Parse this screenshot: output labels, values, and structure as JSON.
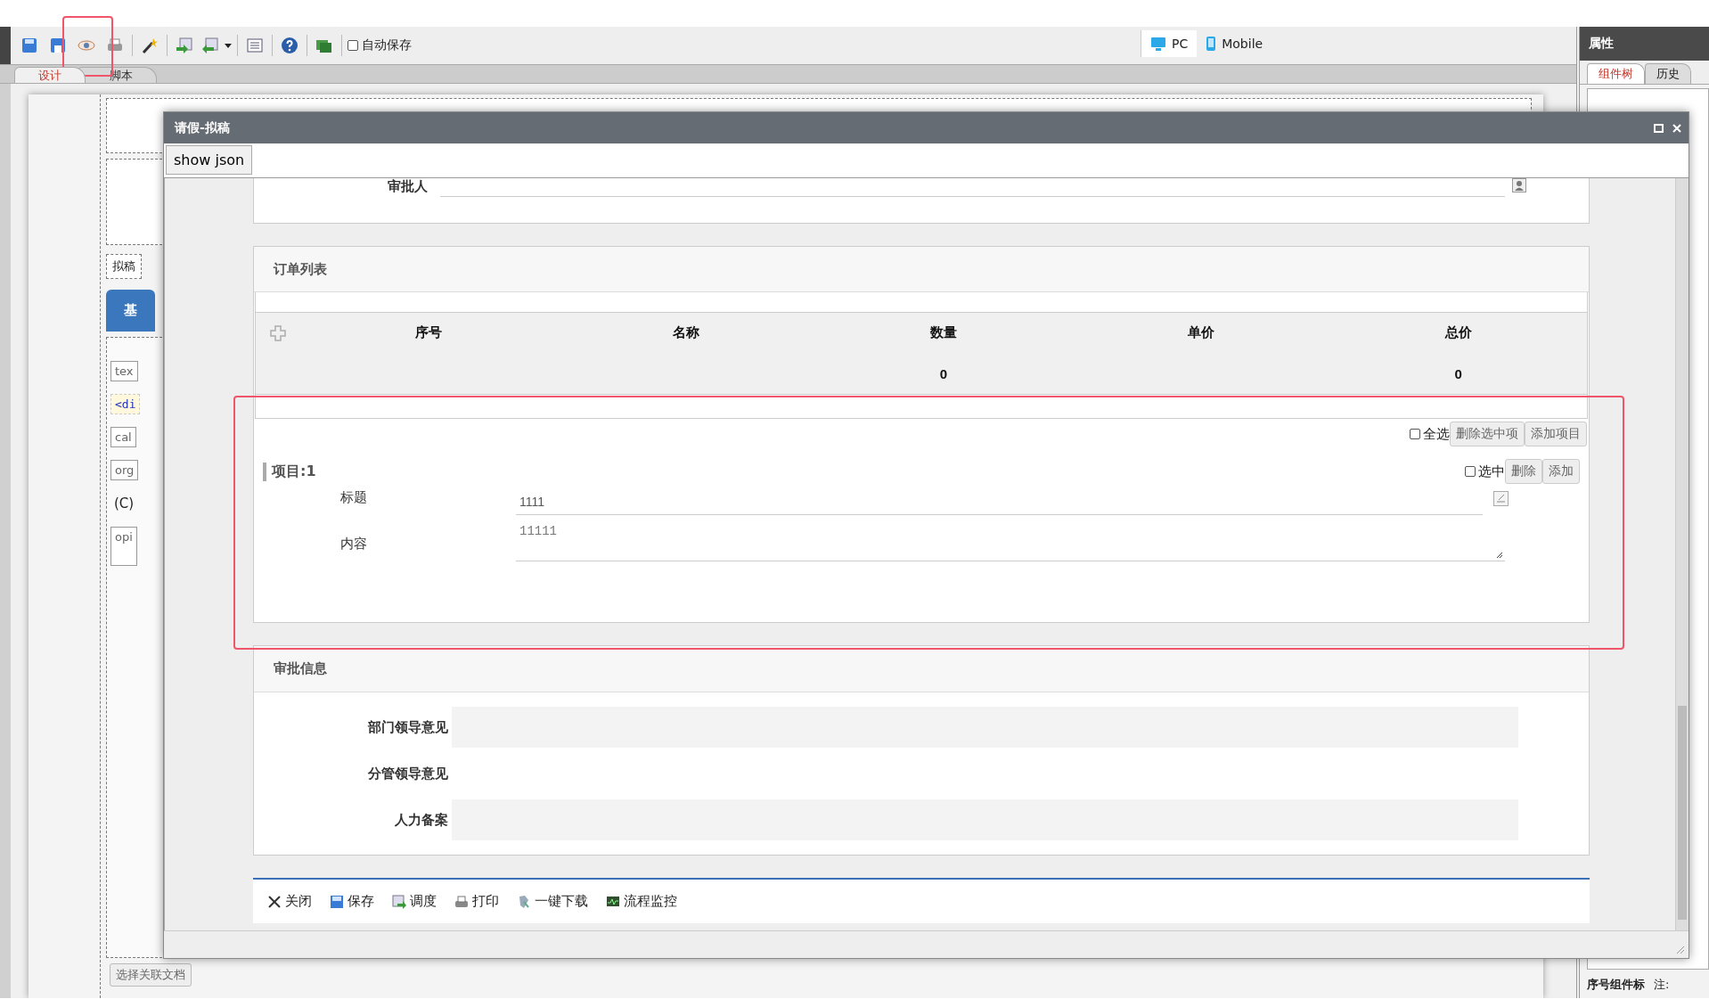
{
  "toolbar": {
    "autosave": {
      "label": "自动保存",
      "checked": false
    },
    "devices": [
      {
        "label": "PC",
        "kind": "pc",
        "selected": true
      },
      {
        "label": "Mobile",
        "kind": "mobile",
        "selected": false
      }
    ]
  },
  "editor_tabs": [
    {
      "label": "设计",
      "selected": true
    },
    {
      "label": "脚本",
      "selected": false
    }
  ],
  "design_canvas": {
    "draft_label": "拟稿",
    "section_tab": "基",
    "field_stubs": [
      {
        "text": "tex",
        "kind": "input"
      },
      {
        "text": "<di",
        "kind": "code"
      },
      {
        "text": "cal",
        "kind": "input"
      },
      {
        "text": "org",
        "kind": "input"
      },
      {
        "text": "(C)",
        "kind": "plain"
      },
      {
        "text": "opi",
        "kind": "textarea"
      }
    ],
    "link_document_button": "选择关联文档"
  },
  "properties_panel": {
    "title": "属性",
    "tabs": [
      {
        "label": "组件树",
        "selected": true
      },
      {
        "label": "历史",
        "selected": false
      }
    ],
    "footer_columns": [
      "序号组件标",
      "注:"
    ]
  },
  "dialog": {
    "title": "请假-拟稿",
    "show_json_button": "show json",
    "approver": {
      "label": "审批人"
    },
    "order_section": {
      "title": "订单列表",
      "columns": [
        {
          "label": "序号"
        },
        {
          "label": "名称"
        },
        {
          "label": "数量",
          "total": "0"
        },
        {
          "label": "单价"
        },
        {
          "label": "总价",
          "total": "0"
        }
      ],
      "select_all": {
        "label": "全选",
        "checked": false
      },
      "delete_selected_button": "删除选中项",
      "add_item_button": "添加项目",
      "items": [
        {
          "heading": "项目:1",
          "select": {
            "label": "选中",
            "checked": false
          },
          "delete_button": "删除",
          "add_button": "添加",
          "fields": [
            {
              "label": "标题",
              "value": "1111",
              "kind": "input"
            },
            {
              "label": "内容",
              "value": "11111",
              "kind": "textarea"
            }
          ]
        }
      ]
    },
    "approval_section": {
      "title": "审批信息",
      "opinions": [
        {
          "label": "部门领导意见",
          "kind": "box"
        },
        {
          "label": "分管领导意见",
          "kind": "blank"
        },
        {
          "label": "人力备案",
          "kind": "box"
        }
      ]
    },
    "actions": [
      {
        "label": "关闭",
        "kind": "close"
      },
      {
        "label": "保存",
        "kind": "save"
      },
      {
        "label": "调度",
        "kind": "dispatch"
      },
      {
        "label": "打印",
        "kind": "print"
      },
      {
        "label": "一键下载",
        "kind": "download"
      },
      {
        "label": "流程监控",
        "kind": "monitor"
      }
    ]
  }
}
